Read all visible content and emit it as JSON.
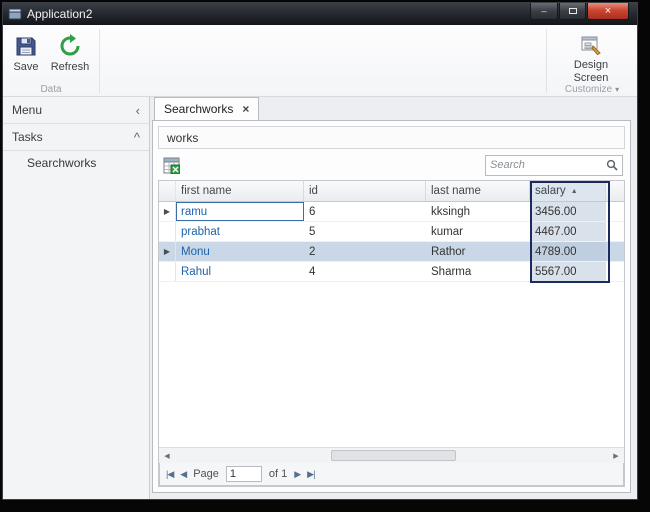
{
  "window": {
    "title": "Application2",
    "minimize_glyph": "–",
    "close_glyph": "×"
  },
  "ribbon": {
    "save_label": "Save",
    "refresh_label": "Refresh",
    "data_group_label": "Data",
    "design_screen_label": "Design Screen",
    "customize_group_label": "Customize",
    "customize_arrow_glyph": "▾"
  },
  "sidebar": {
    "menu_label": "Menu",
    "menu_collapse_glyph": "‹",
    "tasks_label": "Tasks",
    "tasks_collapse_glyph": "^",
    "items": [
      {
        "label": "Searchworks"
      }
    ]
  },
  "main": {
    "tab_label": "Searchworks",
    "tab_close_glyph": "×",
    "panel_title": "works",
    "search_placeholder": "Search",
    "grid": {
      "columns": [
        {
          "label": "first name"
        },
        {
          "label": "id"
        },
        {
          "label": "last name"
        },
        {
          "label": "salary",
          "sort_glyph": "▲"
        }
      ],
      "row_indicator_glyph": "▶",
      "rows": [
        {
          "first_name": "ramu",
          "id": "6",
          "last_name": "kksingh",
          "salary": "3456.00"
        },
        {
          "first_name": "prabhat",
          "id": "5",
          "last_name": "kumar",
          "salary": "4467.00"
        },
        {
          "first_name": "Monu",
          "id": "2",
          "last_name": "Rathor",
          "salary": "4789.00"
        },
        {
          "first_name": "Rahul",
          "id": "4",
          "last_name": "Sharma",
          "salary": "5567.00"
        }
      ]
    },
    "scrollbar": {
      "left_glyph": "◀",
      "right_glyph": "▶"
    },
    "pager": {
      "first_glyph": "|◀",
      "prev_glyph": "◀",
      "page_label": "Page",
      "page_value": "1",
      "of_label": "of 1",
      "next_glyph": "▶",
      "last_glyph": "▶|"
    }
  },
  "colors": {
    "column_highlight": "#1c2a5e",
    "selected_row": "#c9d7e6",
    "link_blue": "#1e62a8"
  }
}
